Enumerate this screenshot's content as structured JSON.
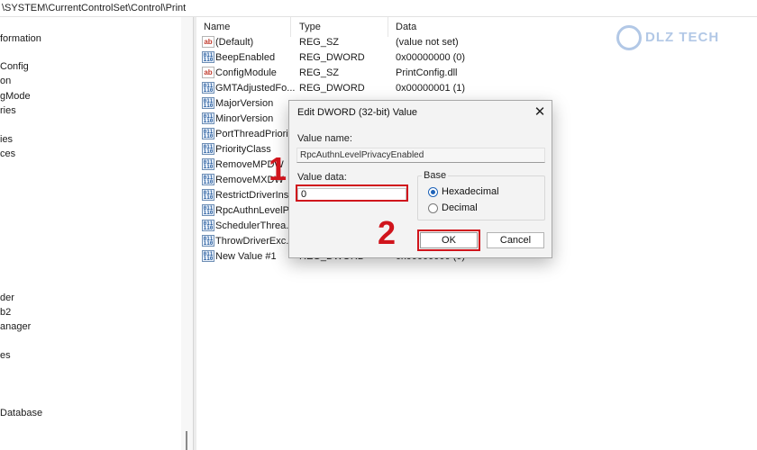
{
  "address": {
    "path": "\\SYSTEM\\CurrentControlSet\\Control\\Print"
  },
  "tree": {
    "items": [
      "formation",
      "Config",
      "on",
      "gMode",
      "ries",
      "ies",
      "ces",
      "der",
      "b2",
      "anager",
      "es",
      "Database"
    ]
  },
  "list": {
    "columns": {
      "name": "Name",
      "type": "Type",
      "data": "Data"
    },
    "rows": [
      {
        "icon": "string-value-icon",
        "name": "(Default)",
        "type": "REG_SZ",
        "data": "(value not set)"
      },
      {
        "icon": "dword-value-icon",
        "name": "BeepEnabled",
        "type": "REG_DWORD",
        "data": "0x00000000 (0)"
      },
      {
        "icon": "string-value-icon",
        "name": "ConfigModule",
        "type": "REG_SZ",
        "data": "PrintConfig.dll"
      },
      {
        "icon": "dword-value-icon",
        "name": "GMTAdjustedFo...",
        "type": "REG_DWORD",
        "data": "0x00000001 (1)"
      },
      {
        "icon": "dword-value-icon",
        "name": "MajorVersion",
        "type": "",
        "data": ""
      },
      {
        "icon": "dword-value-icon",
        "name": "MinorVersion",
        "type": "",
        "data": ""
      },
      {
        "icon": "dword-value-icon",
        "name": "PortThreadPriorit",
        "type": "",
        "data": ""
      },
      {
        "icon": "dword-value-icon",
        "name": "PriorityClass",
        "type": "",
        "data": ""
      },
      {
        "icon": "dword-value-icon",
        "name": "RemoveMPDW",
        "type": "",
        "data": ""
      },
      {
        "icon": "dword-value-icon",
        "name": "RemoveMXDW",
        "type": "",
        "data": ""
      },
      {
        "icon": "dword-value-icon",
        "name": "RestrictDriverIns...",
        "type": "",
        "data": ""
      },
      {
        "icon": "dword-value-icon",
        "name": "RpcAuthnLevelP...",
        "type": "",
        "data": ""
      },
      {
        "icon": "dword-value-icon",
        "name": "SchedulerThrea...",
        "type": "",
        "data": ""
      },
      {
        "icon": "dword-value-icon",
        "name": "ThrowDriverExc...",
        "type": "",
        "data": ""
      },
      {
        "icon": "dword-value-icon",
        "name": "New Value #1",
        "type": "REG_DWORD",
        "data": "0x00000000 (0)"
      }
    ]
  },
  "watermark": {
    "text": "DLZ TECH"
  },
  "dialog": {
    "title": "Edit DWORD (32-bit) Value",
    "close_glyph": "✕",
    "value_name_label": "Value name:",
    "value_name": "RpcAuthnLevelPrivacyEnabled",
    "value_data_label": "Value data:",
    "value_data": "0",
    "base_label": "Base",
    "radio_hex": "Hexadecimal",
    "radio_dec": "Decimal",
    "selected_base": "Hexadecimal",
    "ok_label": "OK",
    "cancel_label": "Cancel"
  },
  "annotations": {
    "step1": "1",
    "step2": "2"
  },
  "colors": {
    "highlight": "#d0141c",
    "accent": "#1f63b8",
    "watermark": "#2563b8"
  }
}
